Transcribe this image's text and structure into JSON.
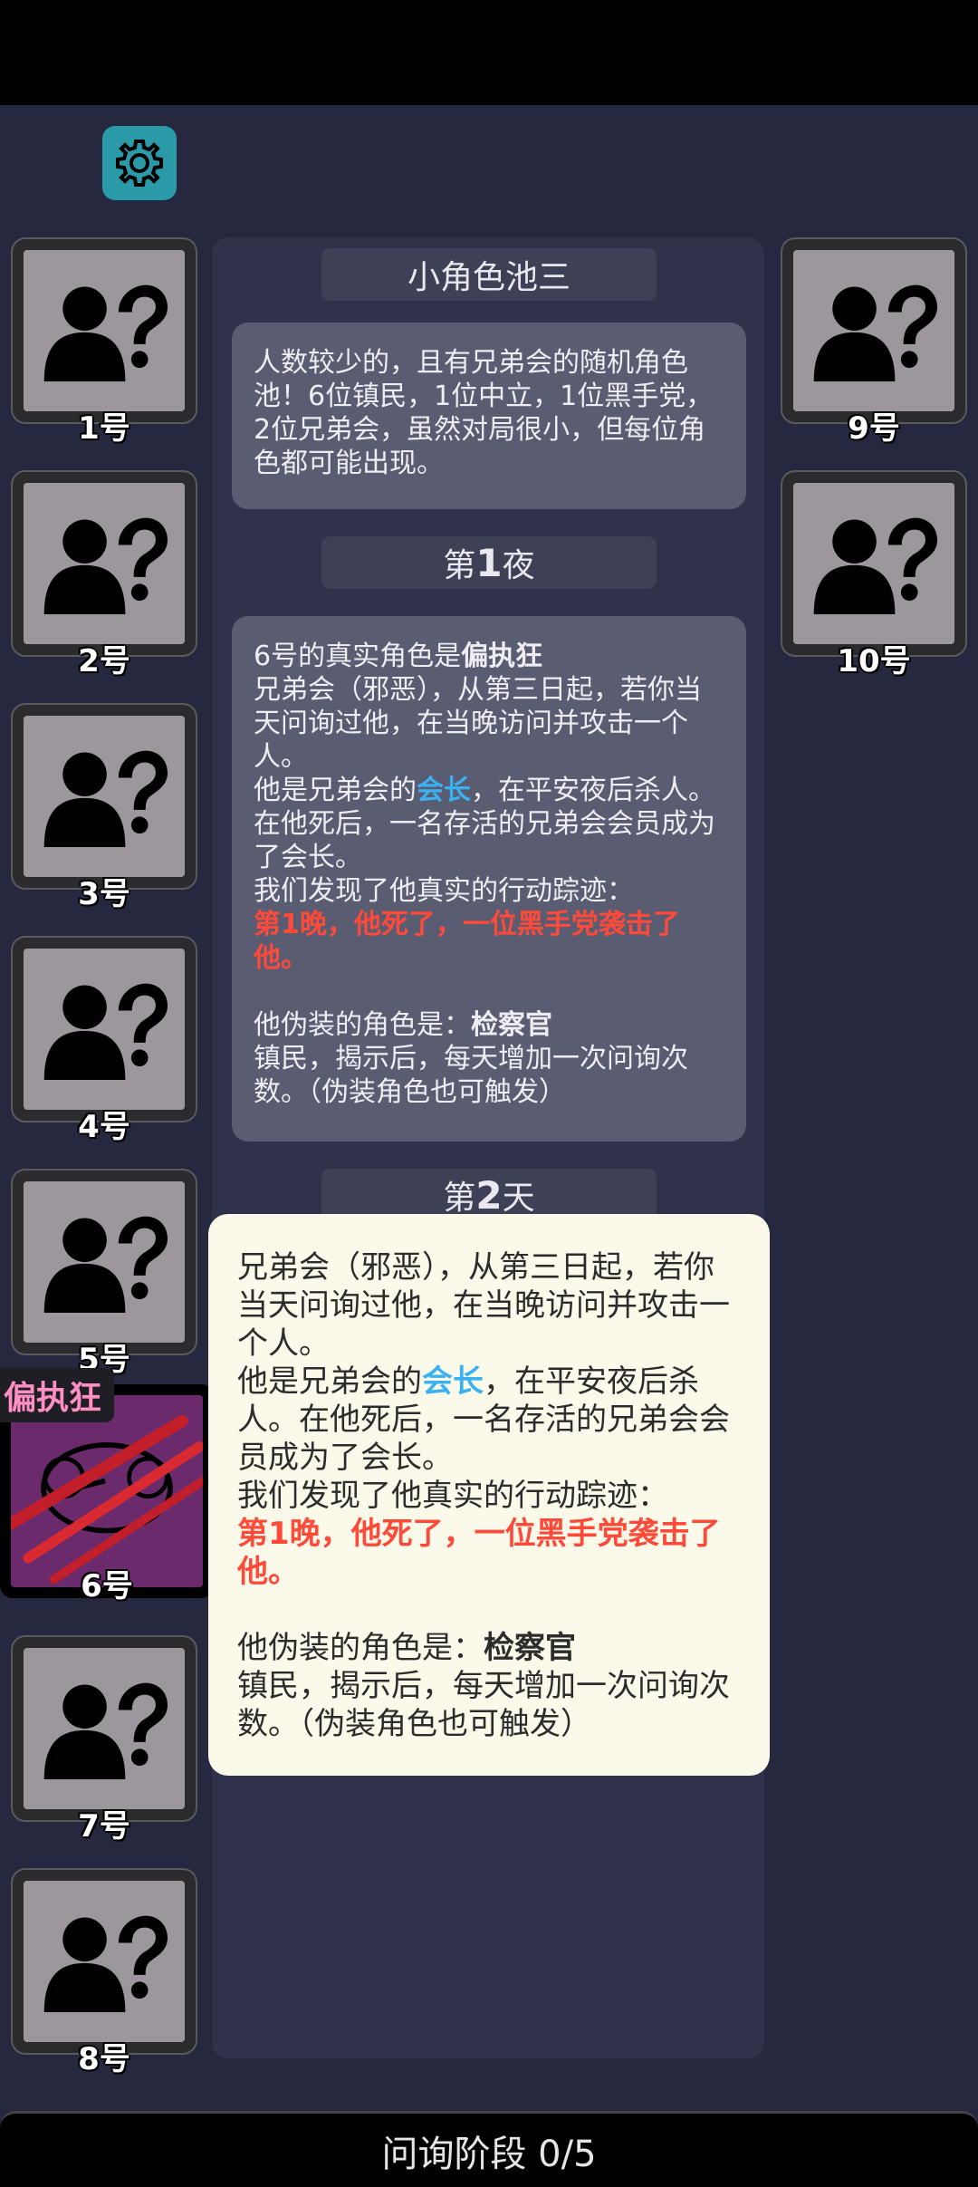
{
  "settings": {
    "icon": "gear-icon"
  },
  "players": [
    {
      "label": "1号",
      "icon": "unknown-player-icon"
    },
    {
      "label": "2号",
      "icon": "unknown-player-icon"
    },
    {
      "label": "3号",
      "icon": "unknown-player-icon"
    },
    {
      "label": "4号",
      "icon": "unknown-player-icon"
    },
    {
      "label": "5号",
      "icon": "unknown-player-icon"
    },
    {
      "label": "6号",
      "icon": "slashed-role-icon",
      "role": "偏执狂"
    },
    {
      "label": "7号",
      "icon": "unknown-player-icon"
    },
    {
      "label": "8号",
      "icon": "unknown-player-icon"
    },
    {
      "label": "9号",
      "icon": "unknown-player-icon"
    },
    {
      "label": "10号",
      "icon": "unknown-player-icon"
    }
  ],
  "log": {
    "pool_title": "小角色池三",
    "pool_desc": "人数较少的，且有兄弟会的随机角色池！6位镇民，1位中立，1位黑手党，2位兄弟会，虽然对局很小，但每位角色都可能出现。",
    "night1": {
      "prefix": "第",
      "num": "1",
      "suffix": "夜"
    },
    "night1_msg": {
      "line1_prefix": "6号的真实角色是",
      "role": "偏执狂",
      "desc1": "兄弟会（邪恶），从第三日起，若你当天问询过他，在当晚访问并攻击一个人。",
      "desc2_prefix": "他是兄弟会的",
      "desc2_highlight": "会长",
      "desc2_suffix": "，在平安夜后杀人。在他死后，一名存活的兄弟会会员成为了会长。",
      "trace_label": "我们发现了他真实的行动踪迹：",
      "trace": "第1晚，他死了，一位黑手党袭击了他。",
      "disguise_prefix": "他伪装的角色是：",
      "disguise_role": "检察官",
      "disguise_desc": "镇民，揭示后，每天增加一次问询次数。（伪装角色也可触发）"
    },
    "day2": {
      "prefix": "第",
      "num": "2",
      "suffix": "天"
    }
  },
  "popup": {
    "desc1": "兄弟会（邪恶），从第三日起，若你当天问询过他，在当晚访问并攻击一个人。",
    "desc2_prefix": "他是兄弟会的",
    "desc2_highlight": "会长",
    "desc2_suffix": "，在平安夜后杀人。在他死后，一名存活的兄弟会会员成为了会长。",
    "trace_label": "我们发现了他真实的行动踪迹：",
    "trace": "第1晚，他死了，一位黑手党袭击了他。",
    "disguise_prefix": "他伪装的角色是：",
    "disguise_role": "检察官",
    "disguise_desc": "镇民，揭示后，每天增加一次问询次数。（伪装角色也可触发）"
  },
  "phase": {
    "label": "问询阶段 0/5"
  },
  "colors": {
    "background": "#262840",
    "accent_red": "#ff4a3a",
    "accent_blue": "#3ab2f2",
    "settings_teal": "#2a9aa8"
  }
}
